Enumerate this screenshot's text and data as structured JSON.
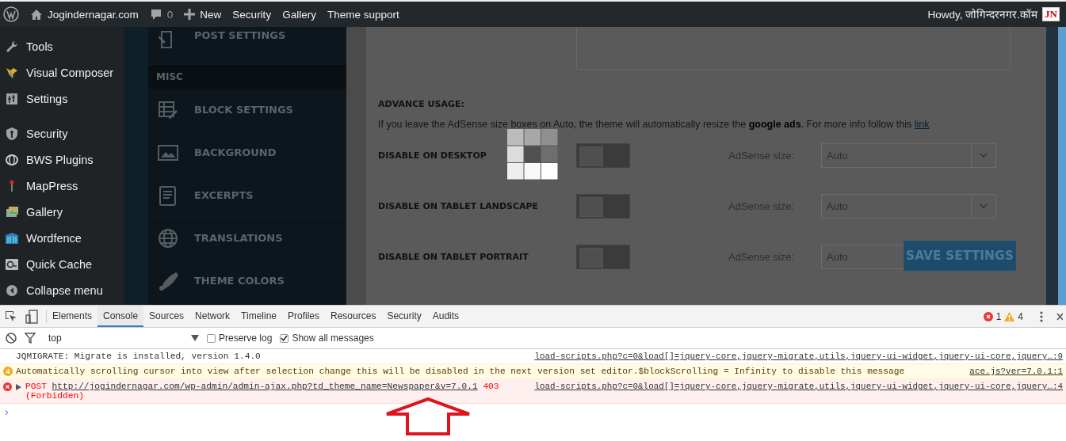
{
  "admin_bar": {
    "site": "Jogindernagar.com",
    "comments": "0",
    "new_label": "New",
    "links": [
      "Security",
      "Gallery",
      "Theme support"
    ],
    "greeting": "Howdy, जोगिन्दरनगर.कॉम",
    "avatar": "JN"
  },
  "sidebar": {
    "groups": [
      {
        "items": [
          {
            "label": "Tools"
          },
          {
            "label": "Visual Composer"
          },
          {
            "label": "Settings"
          }
        ]
      },
      {
        "items": [
          {
            "label": "Security"
          },
          {
            "label": "BWS Plugins"
          },
          {
            "label": "MapPress"
          },
          {
            "label": "Gallery"
          },
          {
            "label": "Wordfence"
          },
          {
            "label": "Quick Cache"
          },
          {
            "label": "Collapse menu"
          }
        ]
      }
    ]
  },
  "theme_menu": [
    {
      "kind": "item",
      "label": "POST SETTINGS"
    },
    {
      "kind": "header",
      "label": "MISC"
    },
    {
      "kind": "item",
      "label": "BLOCK SETTINGS"
    },
    {
      "kind": "item",
      "label": "BACKGROUND"
    },
    {
      "kind": "item",
      "label": "EXCERPTS"
    },
    {
      "kind": "item",
      "label": "TRANSLATIONS"
    },
    {
      "kind": "item",
      "label": "THEME COLORS"
    }
  ],
  "settings": {
    "heading": "ADVANCE USAGE:",
    "description": "If you leave the AdSense size boxes on Auto, the theme will automatically resize the **google ads**. For more info follow this",
    "link": "link",
    "rows": [
      {
        "label": "DISABLE ON DESKTOP",
        "on": false,
        "size_label": "AdSense size:",
        "value": "Auto"
      },
      {
        "label": "DISABLE ON TABLET LANDSCAPE",
        "on": false,
        "size_label": "AdSense size:",
        "value": "Auto"
      },
      {
        "label": "DISABLE ON TABLET PORTRAIT",
        "on": false,
        "size_label": "AdSense size:",
        "value": "Auto"
      }
    ],
    "save_button": "SAVE SETTINGS",
    "loading": true
  },
  "devtools": {
    "tabs": [
      {
        "label": "Elements",
        "selected": false
      },
      {
        "label": "Console",
        "selected": true
      },
      {
        "label": "Sources",
        "selected": false
      },
      {
        "label": "Network",
        "selected": false
      },
      {
        "label": "Timeline",
        "selected": false
      },
      {
        "label": "Profiles",
        "selected": false
      },
      {
        "label": "Resources",
        "selected": false
      },
      {
        "label": "Security",
        "selected": false
      },
      {
        "label": "Audits",
        "selected": false
      }
    ],
    "error_count": "1",
    "warning_count": "4",
    "context": "top",
    "options": [
      {
        "label": "Preserve log",
        "checked": false
      },
      {
        "label": "Show all messages",
        "checked": true
      }
    ],
    "messages": [
      {
        "kind": "log",
        "text": "JQMIGRATE: Migrate is installed, version 1.4.0",
        "source": "load-scripts.php?c=0&load[]=jquery-core,jquery-migrate,utils,jquery-ui-widget,jquery-ui-core,jquery…:9"
      },
      {
        "kind": "warning",
        "count": "4",
        "text": "Automatically scrolling cursor into view after selection change this will be disabled in the next version set editor.$blockScrolling = Infinity to disable this message",
        "source": "ace.js?ver=7.0.1:1"
      },
      {
        "kind": "error",
        "method": "POST",
        "url": "http://jogindernagar.com/wp-admin/admin-ajax.php?td_theme_name=Newspaper&v=7.0.1",
        "status": "403",
        "text": "(Forbidden)",
        "source": "load-scripts.php?c=0&load[]=jquery-core,jquery-migrate,utils,jquery-ui-widget,jquery-ui-core,jquery…:4"
      }
    ],
    "prompt": "›"
  },
  "annotation": {
    "kind": "arrow"
  }
}
